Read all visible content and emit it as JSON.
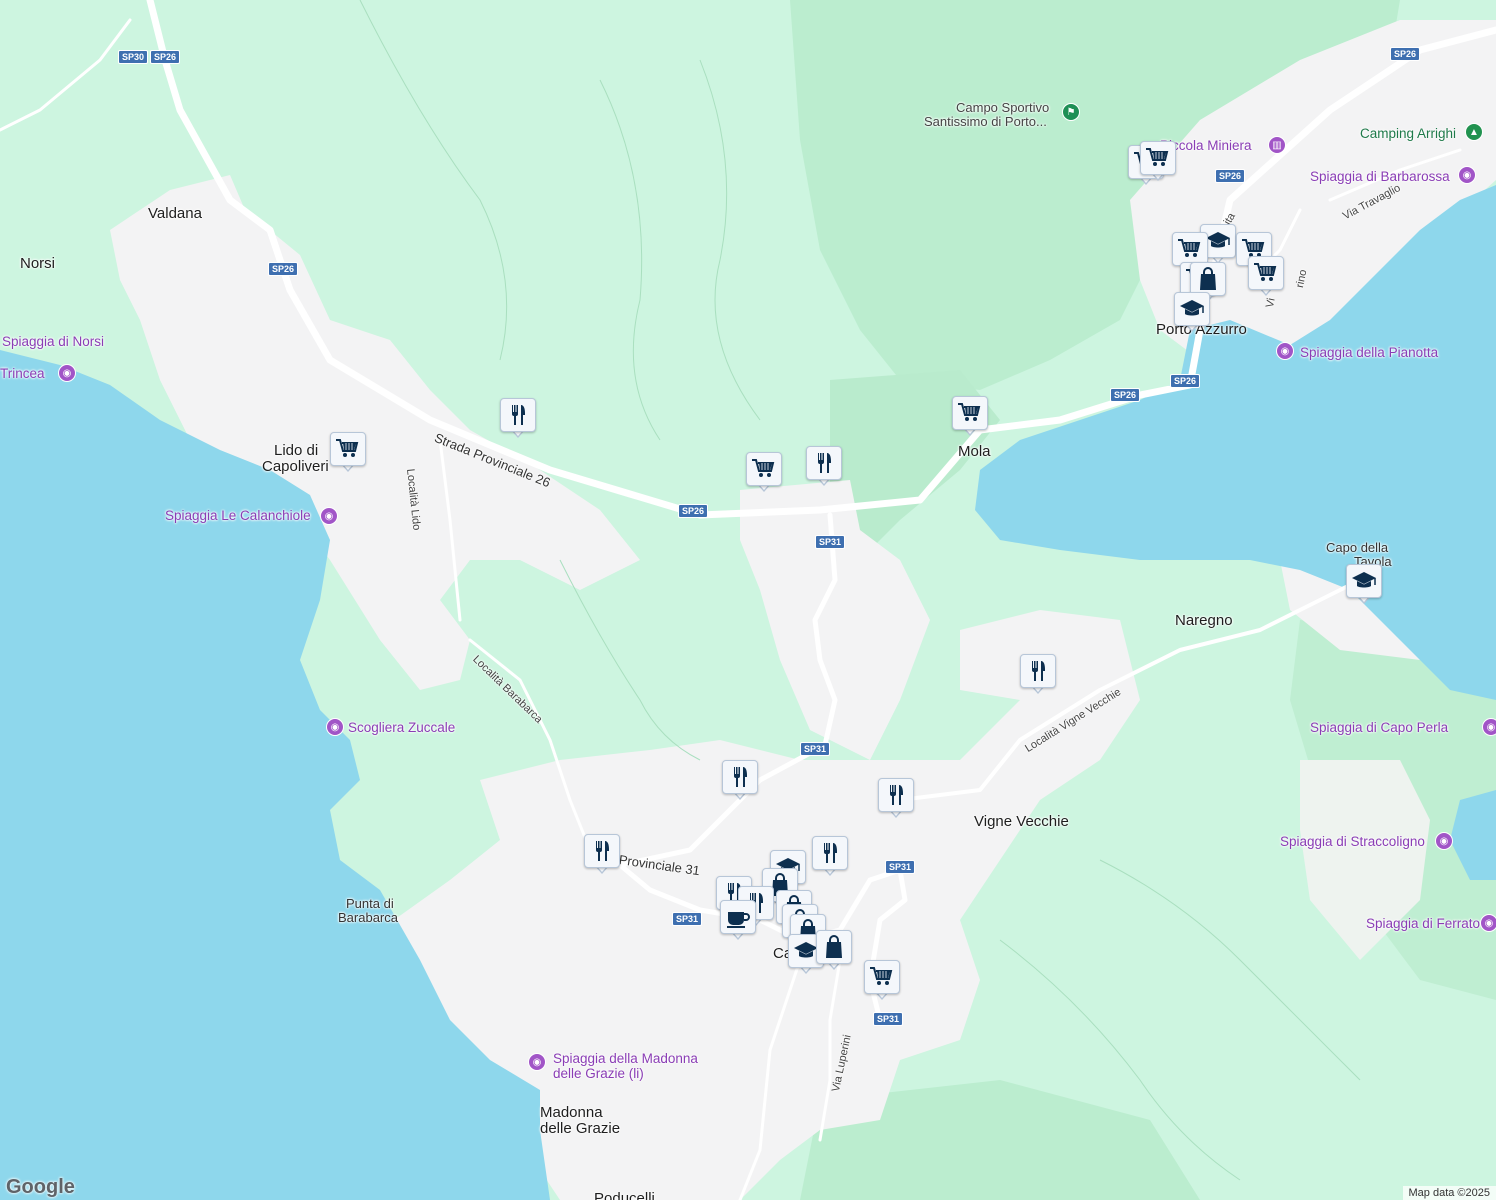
{
  "map": {
    "labels": {
      "valdana": "Valdana",
      "norsi": "Norsi",
      "spiaggia_norsi": "Spiaggia di Norsi",
      "trincea": "Trincea",
      "lido_1": "Lido di",
      "lido_2": "Capoliveri",
      "calanchiole": "Spiaggia Le Calanchiole",
      "localita_lido": "Località Lido",
      "strada_prov_26": "Strada Provinciale 26",
      "localita_barabarca": "Località Barabarca",
      "zuccale": "Scogliera Zuccale",
      "punta_1": "Punta di",
      "punta_2": "Barabarca",
      "prov_31": "Provinciale 31",
      "madonna_spiaggia_1": "Spiaggia della Madonna",
      "madonna_spiaggia_2": "delle Grazie (li)",
      "madonna_1": "Madonna",
      "madonna_2": "delle Grazie",
      "capoliveri_town": "Ca",
      "via_luperini": "Via Luperini",
      "poducelli": "Poducelli",
      "campo_1": "Campo Sportivo",
      "campo_2": "Santissimo di Porto...",
      "piccola_miniera": "Piccola Miniera",
      "camping": "Camping Arrighi",
      "barbarossa": "Spiaggia di Barbarossa",
      "via_travaglio": "Via Travaglio",
      "porto_azzurro": "Porto Azzurro",
      "pianotta": "Spiaggia della Pianotta",
      "mola": "Mola",
      "capo_tavola_1": "Capo della",
      "capo_tavola_2": "Tavola",
      "naregno": "Naregno",
      "vigne_vecchie_loc": "Località Vigne Vecchie",
      "capo_perla": "Spiaggia di Capo Perla",
      "vigne_vecchie": "Vigne Vecchie",
      "stracoligno": "Spiaggia di Straccoligno",
      "ferrato": "Spiaggia di Ferrato",
      "vita": "ita",
      "vi_rino": "Vi",
      "rino": "rino"
    },
    "road_shields": [
      "SP30",
      "SP26",
      "SP26",
      "SP26",
      "SP26",
      "SP26",
      "SP31",
      "SP31",
      "SP31",
      "SP31",
      "SP26",
      "SP31"
    ],
    "attribution": "Map data ©2025",
    "logo": "Google",
    "colors": {
      "land": "#cdf5e0",
      "forest": "#b9ebcd",
      "urban": "#f3f3f4",
      "sea": "#8ed7ec",
      "road": "#ffffff",
      "marker_icon": "#0d2f4f",
      "poi": "#a155c7"
    }
  }
}
